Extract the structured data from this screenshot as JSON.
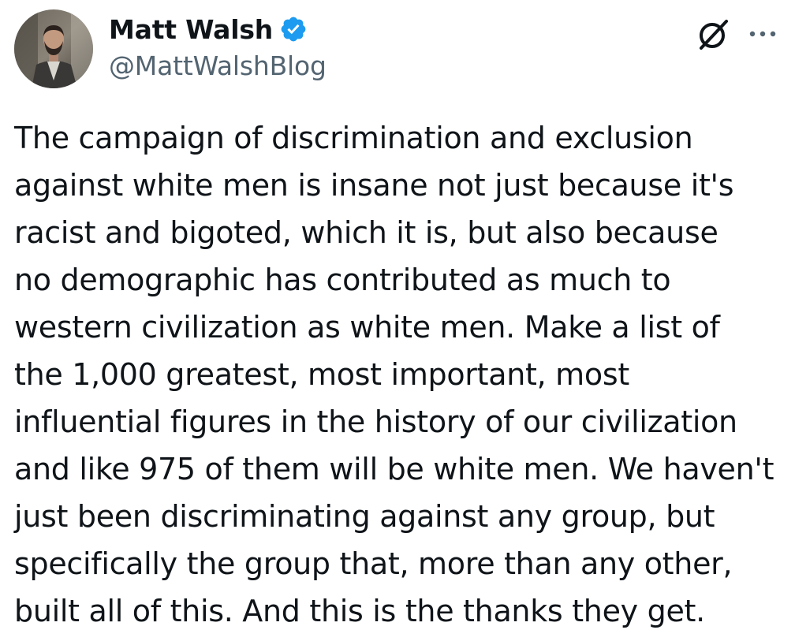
{
  "author": {
    "display_name": "Matt Walsh",
    "handle": "@MattWalshBlog",
    "verified": true,
    "avatar_icon": "profile-photo"
  },
  "actions": {
    "grok_icon": "grok-icon",
    "more_icon": "more-dots-icon"
  },
  "tweet": {
    "text": "The campaign of discrimination and exclusion\nagainst white men is insane not just because it's\nracist and bigoted, which it is, but also because\nno demographic has contributed as much to\nwestern civilization as white men. Make a list of\nthe 1,000 greatest, most important, most\ninfluential figures in the history of our civilization\nand like 975 of them will be white men. We haven't\njust been discriminating against any group, but\nspecifically the group that, more than any other,\nbuilt all of this. And this is the thanks they get."
  },
  "colors": {
    "text": "#0f1419",
    "secondary": "#536471",
    "verified_blue": "#1d9bf0",
    "background": "#ffffff"
  }
}
